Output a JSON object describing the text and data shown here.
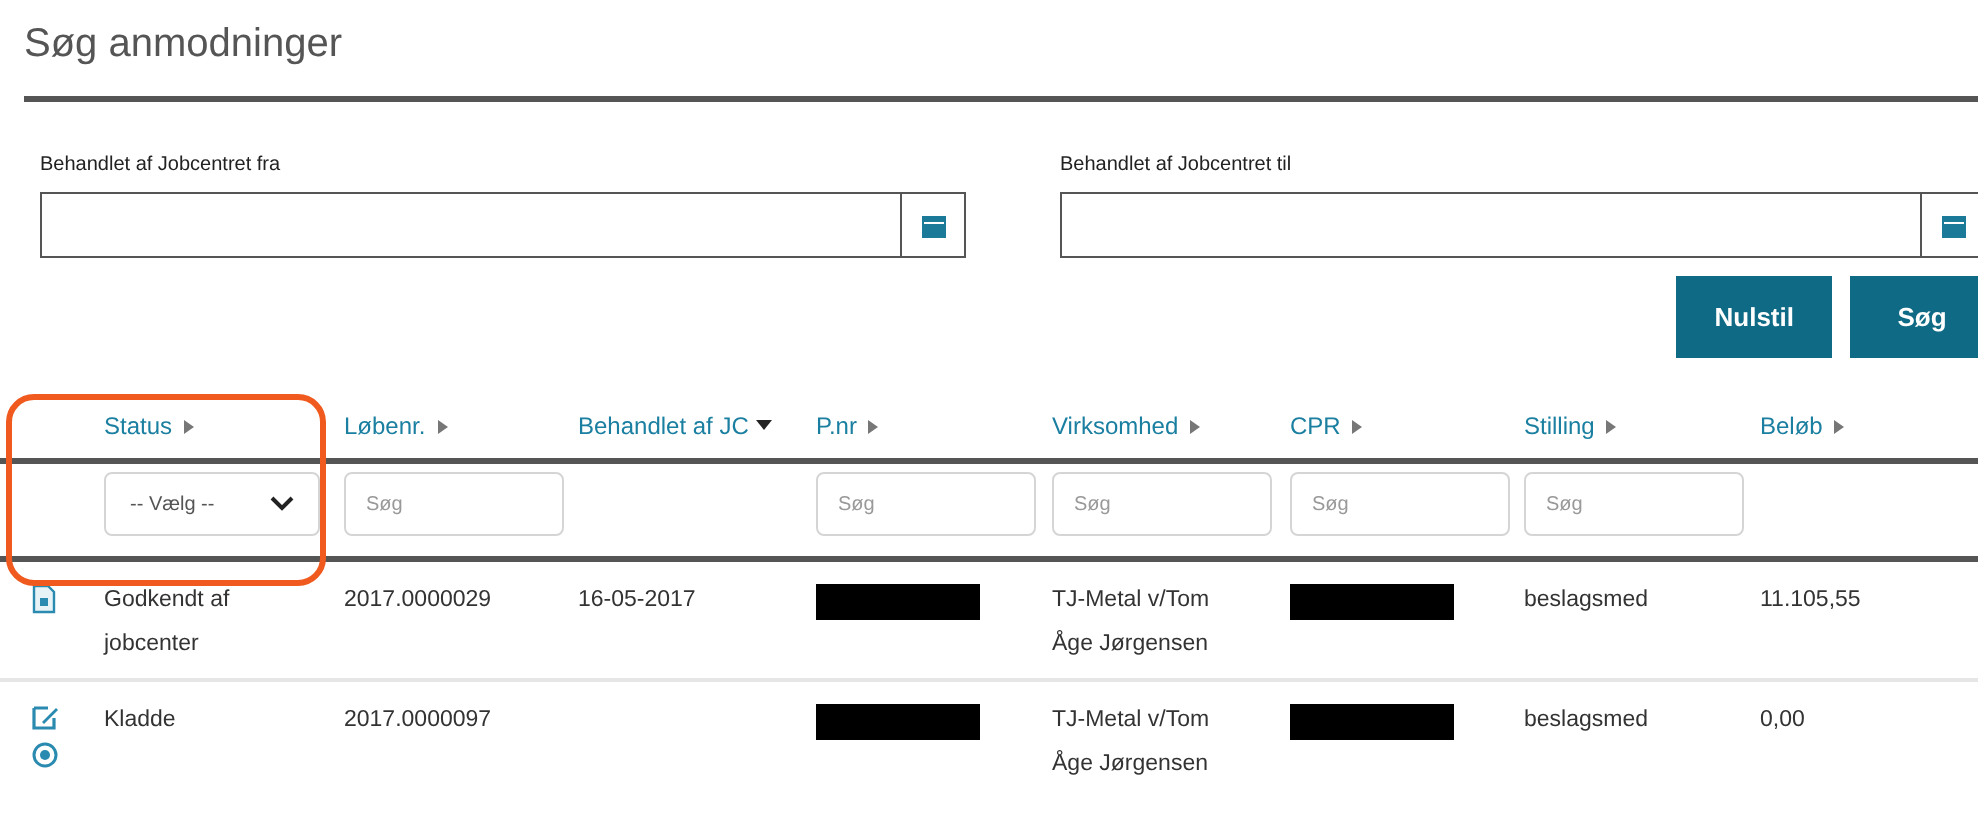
{
  "title": "Søg anmodninger",
  "date_fields": [
    {
      "label": "Behandlet af Jobcentret fra"
    },
    {
      "label": "Behandlet af Jobcentret til"
    }
  ],
  "buttons": [
    "Nulstil",
    "Søg"
  ],
  "table": {
    "columns": [
      {
        "label": "Status",
        "sorted": false,
        "filter": {
          "kind": "select",
          "value": "-- Vælg --"
        }
      },
      {
        "label": "Løbenr.",
        "sorted": false,
        "filter": {
          "kind": "search",
          "placeholder": "Søg"
        }
      },
      {
        "label": "Behandlet af JC",
        "sorted": true,
        "filter": {
          "kind": "none"
        }
      },
      {
        "label": "P.nr",
        "sorted": false,
        "filter": {
          "kind": "search",
          "placeholder": "Søg"
        }
      },
      {
        "label": "Virksomhed",
        "sorted": false,
        "filter": {
          "kind": "search",
          "placeholder": "Søg"
        }
      },
      {
        "label": "CPR",
        "sorted": false,
        "filter": {
          "kind": "search",
          "placeholder": "Søg"
        }
      },
      {
        "label": "Stilling",
        "sorted": false,
        "filter": {
          "kind": "search",
          "placeholder": "Søg"
        }
      },
      {
        "label": "Beløb",
        "sorted": false,
        "filter": {
          "kind": "none"
        }
      }
    ],
    "rows": [
      {
        "icons": [
          {
            "kind": "document"
          }
        ],
        "cells": [
          {
            "kind": "text",
            "text": "Godkendt af jobcenter"
          },
          {
            "kind": "text",
            "text": "2017.0000029"
          },
          {
            "kind": "text",
            "text": "16-05-2017"
          },
          {
            "kind": "redacted"
          },
          {
            "kind": "text",
            "text": "TJ-Metal v/Tom Åge Jørgensen"
          },
          {
            "kind": "redacted"
          },
          {
            "kind": "text",
            "text": "beslagsmed"
          },
          {
            "kind": "text",
            "text": "11.105,55"
          }
        ]
      },
      {
        "icons": [
          {
            "kind": "edit"
          },
          {
            "kind": "cancel"
          }
        ],
        "cells": [
          {
            "kind": "text",
            "text": "Kladde"
          },
          {
            "kind": "text",
            "text": "2017.0000097"
          },
          {
            "kind": "empty"
          },
          {
            "kind": "redacted"
          },
          {
            "kind": "text",
            "text": "TJ-Metal v/Tom Åge Jørgensen"
          },
          {
            "kind": "redacted"
          },
          {
            "kind": "text",
            "text": "beslagsmed"
          },
          {
            "kind": "text",
            "text": "0,00"
          }
        ]
      }
    ]
  }
}
